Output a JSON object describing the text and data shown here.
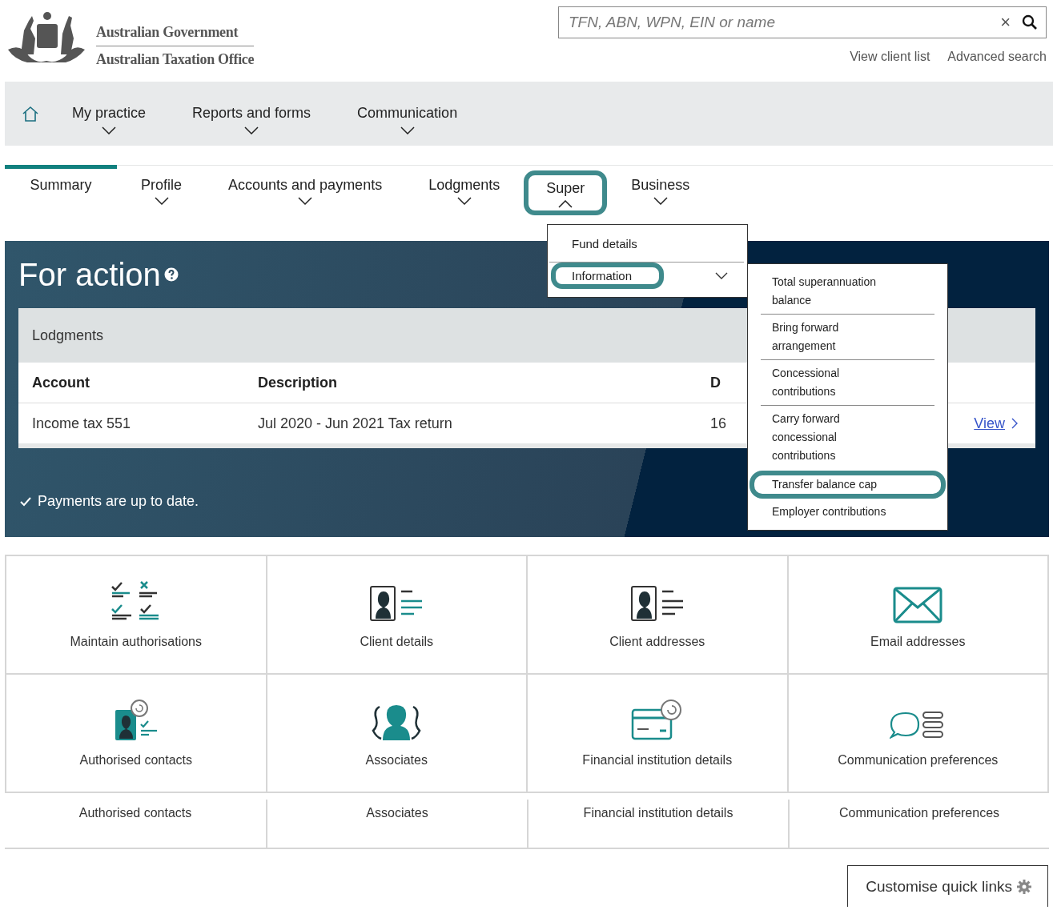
{
  "header": {
    "logo_lines": [
      "Australian Government",
      "Australian Taxation Office"
    ],
    "search": {
      "placeholder": "TFN, ABN, WPN, EIN or name",
      "clear": "×"
    },
    "links": [
      "View client list",
      "Advanced search"
    ]
  },
  "main_nav": [
    {
      "label": "My practice"
    },
    {
      "label": "Reports and forms"
    },
    {
      "label": "Communication"
    }
  ],
  "tabs": [
    {
      "label": "Summary",
      "selected": true,
      "kind": "plain",
      "highlighted": false
    },
    {
      "label": "Profile",
      "selected": false,
      "kind": "dropdown",
      "expanded": false,
      "highlighted": false
    },
    {
      "label": "Accounts and payments",
      "selected": false,
      "kind": "dropdown",
      "expanded": false,
      "highlighted": false
    },
    {
      "label": "Lodgments",
      "selected": false,
      "kind": "dropdown",
      "expanded": false,
      "highlighted": false
    },
    {
      "label": "Super",
      "selected": false,
      "kind": "dropdown",
      "expanded": true,
      "highlighted": true
    },
    {
      "label": "Business",
      "selected": false,
      "kind": "dropdown",
      "expanded": false,
      "highlighted": false
    }
  ],
  "super_menu": [
    {
      "label": "Fund details",
      "highlighted": false,
      "kind": "link"
    },
    {
      "label": "Information",
      "highlighted": true,
      "kind": "submenu"
    }
  ],
  "information_menu": [
    {
      "label": "Total superannuation balance",
      "highlighted": false
    },
    {
      "label": "Bring forward arrangement",
      "highlighted": false
    },
    {
      "label": "Concessional contributions",
      "highlighted": false
    },
    {
      "label": "Carry forward concessional contributions",
      "highlighted": false
    },
    {
      "label": "Transfer balance cap",
      "highlighted": true
    },
    {
      "label": "Employer contributions",
      "highlighted": false
    }
  ],
  "for_action": {
    "title": "For action",
    "card_title": "Lodgments",
    "columns": [
      "Account",
      "Description",
      "D"
    ],
    "rows": [
      {
        "cells": [
          "Income tax 551",
          "Jul 2020 - Jun 2021 Tax return",
          "16"
        ],
        "link": "View"
      }
    ],
    "status": "Payments are up to date."
  },
  "quick_links": [
    {
      "label": "Maintain authorisations",
      "kind": "authorisations"
    },
    {
      "label": "Client details",
      "kind": "client-card"
    },
    {
      "label": "Client addresses",
      "kind": "client-list"
    },
    {
      "label": "Email addresses",
      "kind": "envelope"
    },
    {
      "label": "Authorised contacts",
      "kind": "contact-refresh"
    },
    {
      "label": "Associates",
      "kind": "group"
    },
    {
      "label": "Financial institution details",
      "kind": "card-refresh"
    },
    {
      "label": "Communication preferences",
      "kind": "speech"
    }
  ],
  "quick_text_links": [
    "Authorised contacts",
    "Associates",
    "Financial institution details",
    "Communication preferences"
  ],
  "customise_button": "Customise quick links"
}
